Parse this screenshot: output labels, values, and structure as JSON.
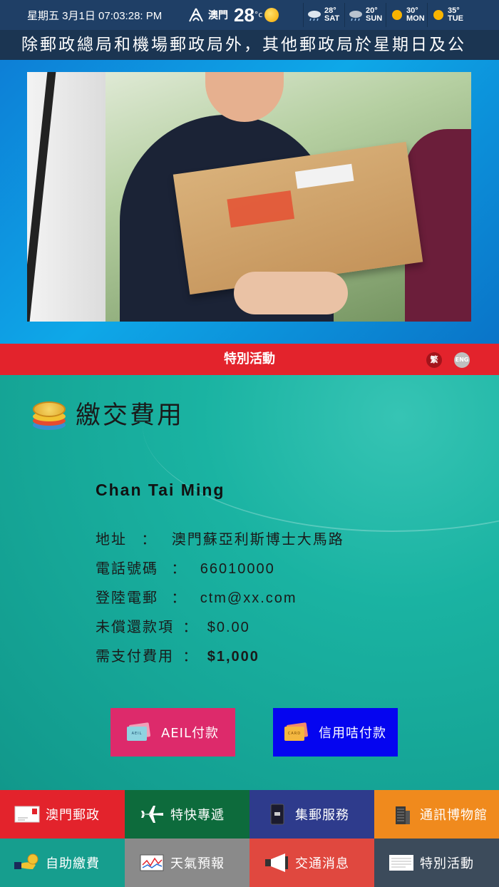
{
  "status_bar": {
    "date_time": "星期五 3月1日 07:03:28: PM",
    "city": "澳門",
    "temperature": "28",
    "unit": "°c",
    "forecast": [
      {
        "temp": "28°",
        "day": "SAT",
        "icon": "rain-cloud-icon"
      },
      {
        "temp": "20°",
        "day": "SUN",
        "icon": "rain-cloud-icon"
      },
      {
        "temp": "30°",
        "day": "MON",
        "icon": "sun-icon"
      },
      {
        "temp": "35°",
        "day": "TUE",
        "icon": "sun-icon"
      }
    ]
  },
  "marquee": "除郵政總局和機場郵政局外，其他郵政局於星期日及公",
  "banner": {
    "image": "courier-delivering-package-photo"
  },
  "title_bar": {
    "title": "特別活動",
    "lang_zh": "繁",
    "lang_en": "ENG"
  },
  "section": {
    "title": "繳交費用",
    "icon": "coins-icon"
  },
  "customer": {
    "name": "Chan Tai Ming",
    "fields": [
      {
        "label": "地址",
        "sep": "：",
        "value": "澳門蘇亞利斯博士大馬路"
      },
      {
        "label": "電話號碼",
        "sep": "：",
        "value": "66010000"
      },
      {
        "label": "登陸電郵",
        "sep": "：",
        "value": "ctm@xx.com"
      },
      {
        "label": "未償還款項",
        "sep": "：",
        "value": "$0.00"
      },
      {
        "label": "需支付費用",
        "sep": "：",
        "value": "$1,000"
      }
    ]
  },
  "payment": {
    "aeil_label": "AEIL付款",
    "aeil_card_text": "AEIL",
    "card_label": "信用咭付款",
    "card_card_text": "CARD",
    "colors": {
      "aeil": "#dd2a6b",
      "card": "#0505f0"
    }
  },
  "nav": [
    {
      "label": "澳門郵政",
      "icon": "envelope-icon",
      "color": "#e3232c"
    },
    {
      "label": "特快專遞",
      "icon": "airplane-icon",
      "color": "#0d6b3c"
    },
    {
      "label": "集郵服務",
      "icon": "stamp-book-icon",
      "color": "#2e3b8c"
    },
    {
      "label": "通訊博物館",
      "icon": "building-icon",
      "color": "#f08a1d"
    },
    {
      "label": "自助繳費",
      "icon": "hand-coin-icon",
      "color": "#169e8e"
    },
    {
      "label": "天氣預報",
      "icon": "weather-chart-icon",
      "color": "#8a8a8a"
    },
    {
      "label": "交通消息",
      "icon": "megaphone-icon",
      "color": "#e0483f"
    },
    {
      "label": "特別活動",
      "icon": "newspaper-icon",
      "color": "#3c4b5b"
    }
  ]
}
